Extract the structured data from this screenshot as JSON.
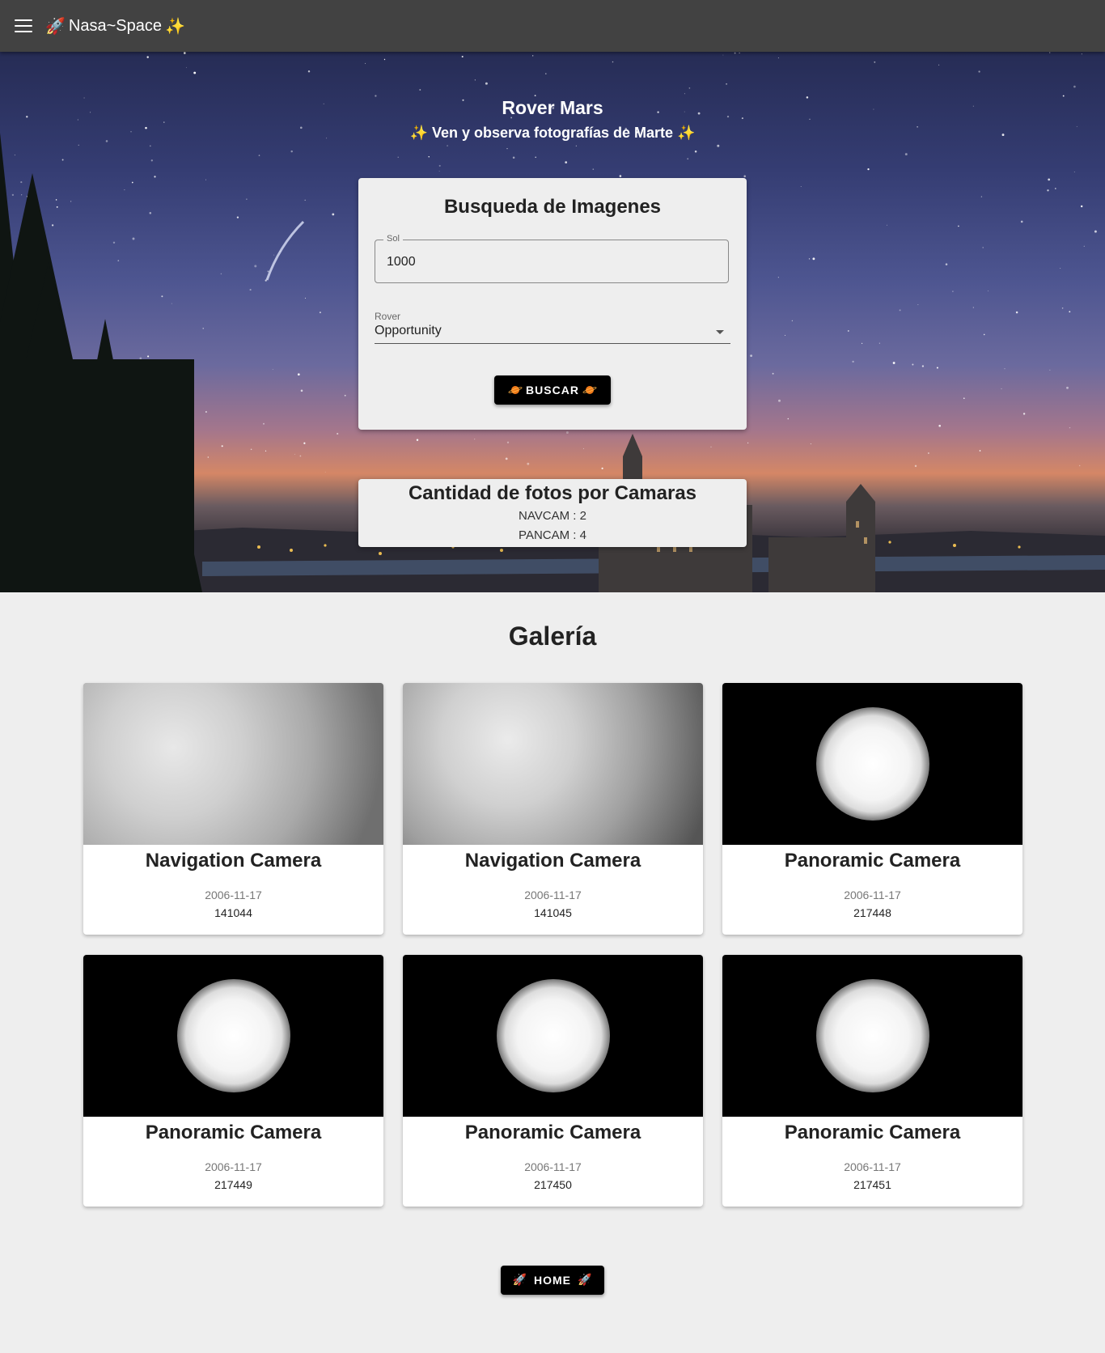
{
  "appbar": {
    "brand_prefix": "🚀",
    "brand": "Nasa~Space",
    "brand_suffix": "✨"
  },
  "hero": {
    "title": "Rover Mars",
    "subtitle": "✨ Ven y observa fotografías de Marte ✨"
  },
  "search": {
    "title": "Busqueda de Imagenes",
    "sol_label": "Sol",
    "sol_value": "1000",
    "rover_label": "Rover",
    "rover_value": "Opportunity",
    "button_label": "BUSCAR"
  },
  "counts": {
    "title": "Cantidad de fotos por Camaras",
    "lines": [
      "NAVCAM : 2",
      "PANCAM : 4"
    ]
  },
  "gallery": {
    "title": "Galería",
    "cards": [
      {
        "camera": "Navigation Camera",
        "date": "2006-11-17",
        "id": "141044",
        "photo": "navcam"
      },
      {
        "camera": "Navigation Camera",
        "date": "2006-11-17",
        "id": "141045",
        "photo": "navcam"
      },
      {
        "camera": "Panoramic Camera",
        "date": "2006-11-17",
        "id": "217448",
        "photo": "pancam"
      },
      {
        "camera": "Panoramic Camera",
        "date": "2006-11-17",
        "id": "217449",
        "photo": "pancam"
      },
      {
        "camera": "Panoramic Camera",
        "date": "2006-11-17",
        "id": "217450",
        "photo": "pancam"
      },
      {
        "camera": "Panoramic Camera",
        "date": "2006-11-17",
        "id": "217451",
        "photo": "pancam"
      }
    ]
  },
  "footer": {
    "home_label": "HOME"
  },
  "icons": {
    "menu": "menu-icon",
    "rocket": "rocket-icon",
    "sparkles": "sparkles-icon",
    "planet": "planet-icon"
  }
}
